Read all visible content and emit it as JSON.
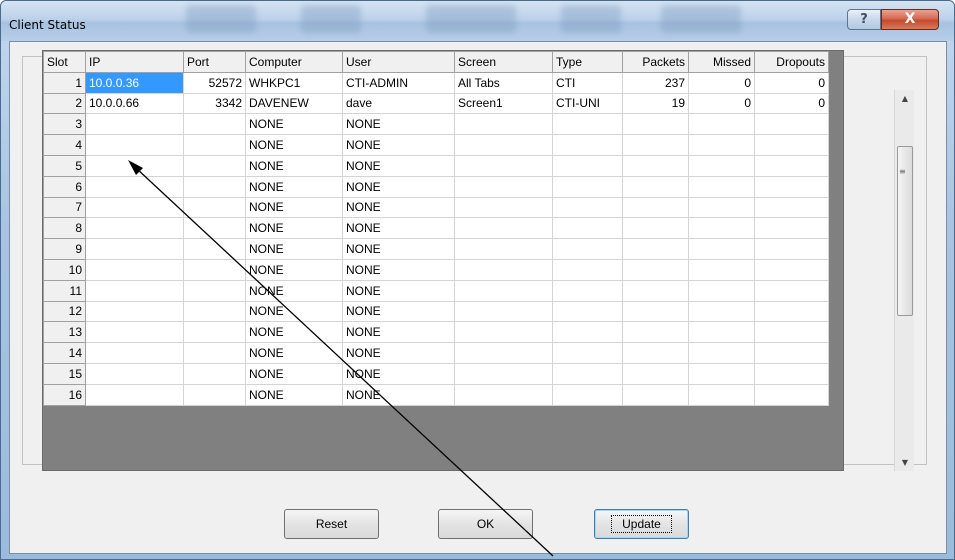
{
  "window": {
    "title": "Client Status",
    "help_glyph": "?",
    "close_glyph": "X"
  },
  "grid": {
    "columns": [
      "Slot",
      "IP",
      "Port",
      "Computer",
      "User",
      "Screen",
      "Type",
      "Packets",
      "Missed",
      "Dropouts"
    ],
    "rows": [
      [
        "1",
        "10.0.0.36",
        "52572",
        "WHKPC1",
        "CTI-ADMIN",
        "All Tabs",
        "CTI",
        "237",
        "0",
        "0"
      ],
      [
        "2",
        "10.0.0.66",
        "3342",
        "DAVENEW",
        "dave",
        "Screen1",
        "CTI-UNI",
        "19",
        "0",
        "0"
      ],
      [
        "3",
        "",
        "",
        "NONE",
        "NONE",
        "",
        "",
        "",
        "",
        ""
      ],
      [
        "4",
        "",
        "",
        "NONE",
        "NONE",
        "",
        "",
        "",
        "",
        ""
      ],
      [
        "5",
        "",
        "",
        "NONE",
        "NONE",
        "",
        "",
        "",
        "",
        ""
      ],
      [
        "6",
        "",
        "",
        "NONE",
        "NONE",
        "",
        "",
        "",
        "",
        ""
      ],
      [
        "7",
        "",
        "",
        "NONE",
        "NONE",
        "",
        "",
        "",
        "",
        ""
      ],
      [
        "8",
        "",
        "",
        "NONE",
        "NONE",
        "",
        "",
        "",
        "",
        ""
      ],
      [
        "9",
        "",
        "",
        "NONE",
        "NONE",
        "",
        "",
        "",
        "",
        ""
      ],
      [
        "10",
        "",
        "",
        "NONE",
        "NONE",
        "",
        "",
        "",
        "",
        ""
      ],
      [
        "11",
        "",
        "",
        "NONE",
        "NONE",
        "",
        "",
        "",
        "",
        ""
      ],
      [
        "12",
        "",
        "",
        "NONE",
        "NONE",
        "",
        "",
        "",
        "",
        ""
      ],
      [
        "13",
        "",
        "",
        "NONE",
        "NONE",
        "",
        "",
        "",
        "",
        ""
      ],
      [
        "14",
        "",
        "",
        "NONE",
        "NONE",
        "",
        "",
        "",
        "",
        ""
      ],
      [
        "15",
        "",
        "",
        "NONE",
        "NONE",
        "",
        "",
        "",
        "",
        ""
      ],
      [
        "16",
        "",
        "",
        "NONE",
        "NONE",
        "",
        "",
        "",
        "",
        ""
      ]
    ],
    "selected_cell": "10.0.0.36"
  },
  "scrollbar": {
    "up_icon": "scroll-up-arrow-icon",
    "down_icon": "scroll-down-arrow-icon",
    "up_glyph": "▲",
    "down_glyph": "▼",
    "grip_glyph": "≡"
  },
  "buttons": {
    "reset_label": "Reset",
    "ok_label": "OK",
    "update_label": "Update"
  },
  "colors": {
    "selection": "#3399ff",
    "close_button": "#c44a2e"
  }
}
